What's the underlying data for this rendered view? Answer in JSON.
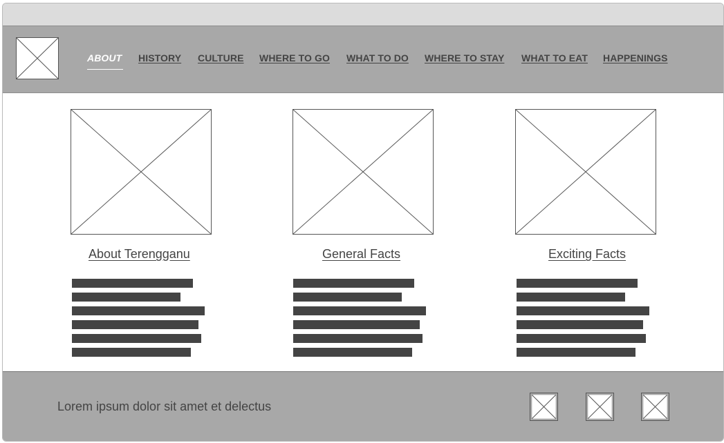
{
  "nav": {
    "items": [
      {
        "label": "ABOUT",
        "active": true
      },
      {
        "label": "HISTORY"
      },
      {
        "label": "CULTURE"
      },
      {
        "label": "WHERE TO GO"
      },
      {
        "label": "WHAT TO DO"
      },
      {
        "label": "WHERE TO STAY"
      },
      {
        "label": "WHAT TO EAT"
      },
      {
        "label": "HAPPENINGS"
      }
    ]
  },
  "cards": [
    {
      "title": "About Terengganu"
    },
    {
      "title": "General Facts"
    },
    {
      "title": "Exciting Facts"
    }
  ],
  "footer": {
    "text": "Lorem ipsum dolor sit amet et delectus"
  }
}
